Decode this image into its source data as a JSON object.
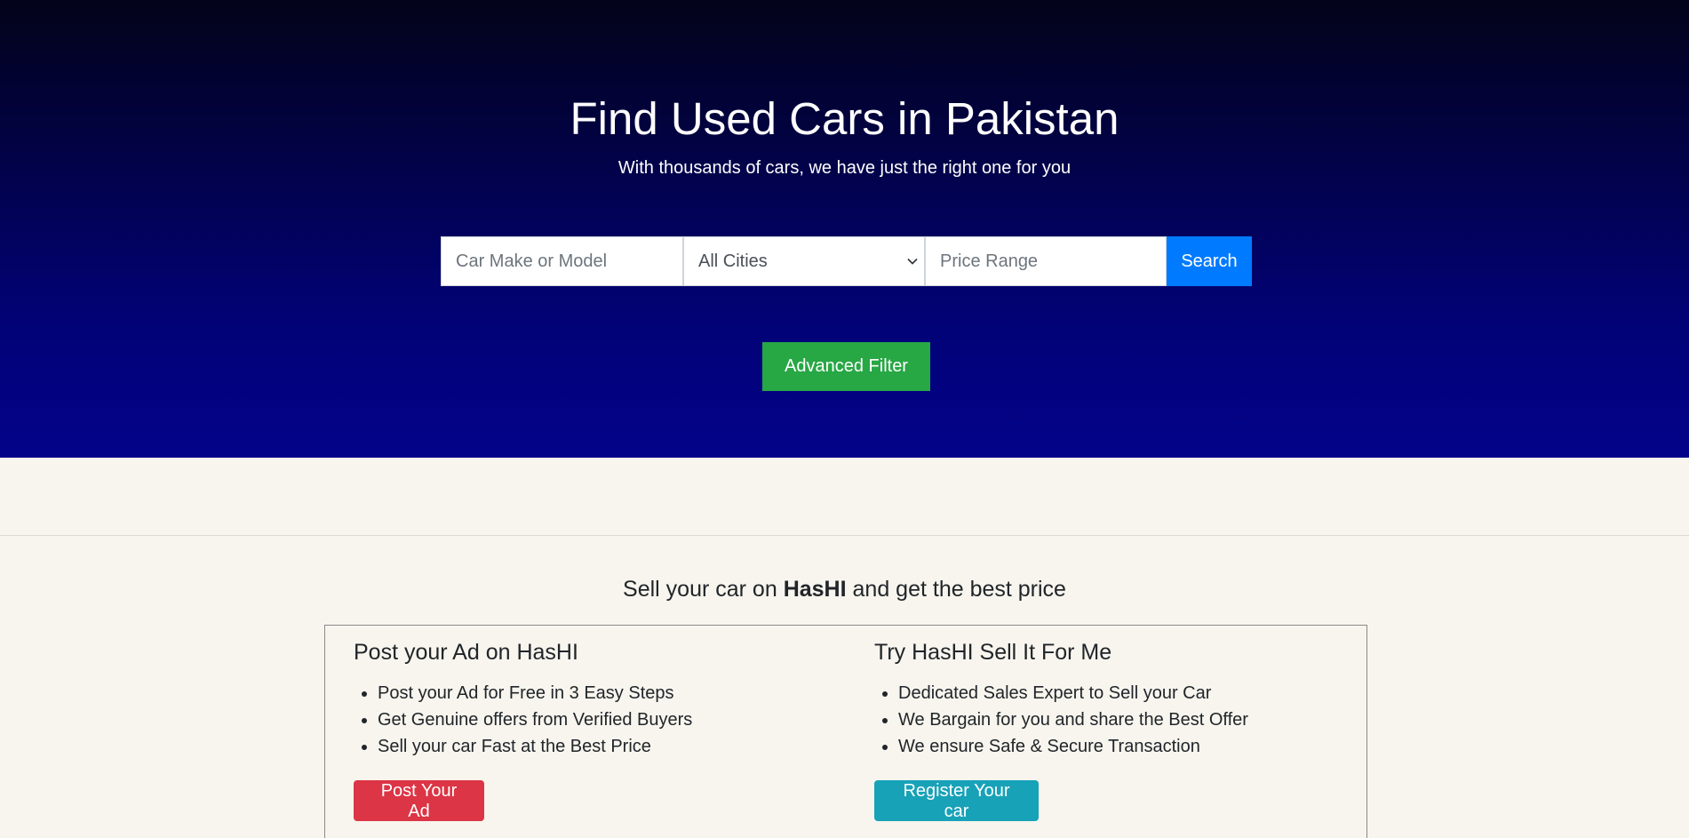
{
  "hero": {
    "title": "Find Used Cars in Pakistan",
    "subtitle": "With thousands of cars, we have just the right one for you",
    "colors": {
      "gradient_top": "#03031a",
      "gradient_bottom": "#03038a"
    }
  },
  "search": {
    "make_placeholder": "Car Make or Model",
    "city_selected": "All Cities",
    "price_placeholder": "Price Range",
    "search_label": "Search",
    "search_color": "#007bff"
  },
  "advanced_filter": {
    "label": "Advanced Filter",
    "color": "#28a745"
  },
  "sell": {
    "heading_prefix": "Sell your car on",
    "brand": "HasHI",
    "heading_suffix": "and get the best price",
    "post_ad": {
      "title": "Post your Ad on HasHI",
      "items": [
        "Post your Ad for Free in 3 Easy Steps",
        "Get Genuine offers from Verified Buyers",
        "Sell your car Fast at the Best Price"
      ],
      "button_label": "Post Your Ad",
      "button_color": "#dc3545"
    },
    "sell_for_me": {
      "title": "Try HasHI Sell It For Me",
      "items": [
        "Dedicated Sales Expert to Sell your Car",
        "We Bargain for you and share the Best Offer",
        "We ensure Safe & Secure Transaction"
      ],
      "button_label": "Register Your car",
      "button_color": "#17a2b8"
    }
  }
}
